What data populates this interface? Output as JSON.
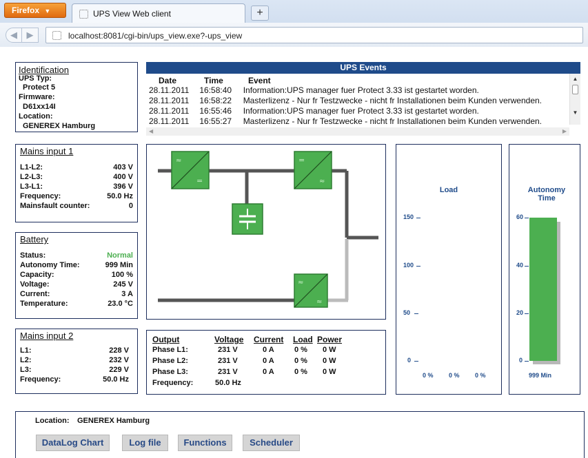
{
  "browser": {
    "menu_label": "Firefox",
    "tab_title": "UPS View Web client",
    "new_tab": "+",
    "url": "localhost:8081/cgi-bin/ups_view.exe?-ups_view"
  },
  "identification": {
    "title": "Identification",
    "ups_type_label": "UPS Typ:",
    "ups_type_value": "Protect 5",
    "firmware_label": "Firmware:",
    "firmware_value": "D61xx14I",
    "location_label": "Location:",
    "location_value": "GENEREX Hamburg"
  },
  "events": {
    "title": "UPS Events",
    "columns": [
      "Date",
      "Time",
      "Event"
    ],
    "rows": [
      {
        "date": "28.11.2011",
        "time": "16:58:40",
        "event": "Information:UPS manager fuer Protect 3.33 ist gestartet worden."
      },
      {
        "date": "28.11.2011",
        "time": "16:58:22",
        "event": "Masterlizenz - Nur fr Testzwecke - nicht fr Installationen beim Kunden verwenden."
      },
      {
        "date": "28.11.2011",
        "time": "16:55:46",
        "event": "Information:UPS manager fuer Protect 3.33 ist gestartet worden."
      },
      {
        "date": "28.11.2011",
        "time": "16:55:27",
        "event": "Masterlizenz - Nur fr Testzwecke - nicht fr Installationen beim Kunden verwenden."
      }
    ]
  },
  "mains1": {
    "title": "Mains input 1",
    "rows": [
      {
        "label": "L1-L2:",
        "value": "403 V"
      },
      {
        "label": "L2-L3:",
        "value": "400 V"
      },
      {
        "label": "L3-L1:",
        "value": "396 V"
      },
      {
        "label": "Frequency:",
        "value": "50.0 Hz"
      },
      {
        "label": "Mainsfault counter:",
        "value": "0"
      }
    ]
  },
  "battery": {
    "title": "Battery",
    "status_color": "#4caf50",
    "rows": [
      {
        "label": "Status:",
        "value": "Normal"
      },
      {
        "label": "Autonomy Time:",
        "value": "999 Min"
      },
      {
        "label": "Capacity:",
        "value": "100 %"
      },
      {
        "label": "Voltage:",
        "value": "245 V"
      },
      {
        "label": "Current:",
        "value": "3 A"
      },
      {
        "label": "Temperature:",
        "value": "23.0 °C"
      }
    ]
  },
  "mains2": {
    "title": "Mains input 2",
    "rows": [
      {
        "label": "L1:",
        "value": "228 V"
      },
      {
        "label": "L2:",
        "value": "232 V"
      },
      {
        "label": "L3:",
        "value": "229 V"
      },
      {
        "label": "Frequency:",
        "value": "50.0 Hz"
      }
    ]
  },
  "output": {
    "headers": [
      "Output",
      "Voltage",
      "Current",
      "Load",
      "Power"
    ],
    "rows": [
      [
        "Phase L1:",
        "231 V",
        "0 A",
        "0 %",
        "0 W"
      ],
      [
        "Phase L2:",
        "231 V",
        "0 A",
        "0 %",
        "0 W"
      ],
      [
        "Phase L3:",
        "231 V",
        "0 A",
        "0 %",
        "0 W"
      ]
    ],
    "frequency_label": "Frequency:",
    "frequency_value": "50.0 Hz"
  },
  "diagram": {
    "block_color": "#4caf50",
    "line_color": "#555555",
    "bypass_color": "#bbbbbb",
    "symbol_ac": "≈",
    "symbol_dc": "="
  },
  "load_chart": {
    "title": "Load",
    "ticks": [
      "150",
      "100",
      "50",
      "0"
    ],
    "values": [
      "0 %",
      "0 %",
      "0 %"
    ]
  },
  "autonomy_chart": {
    "title": "Autonomy Time",
    "ticks": [
      "60",
      "40",
      "20",
      "0"
    ],
    "value_label": "999 Min",
    "fill_fraction": 1.0,
    "bar_color": "#4caf50"
  },
  "footer": {
    "location_label": "Location:",
    "location_value": "GENEREX Hamburg",
    "buttons": [
      "DataLog Chart",
      "Log file",
      "Functions",
      "Scheduler"
    ]
  }
}
